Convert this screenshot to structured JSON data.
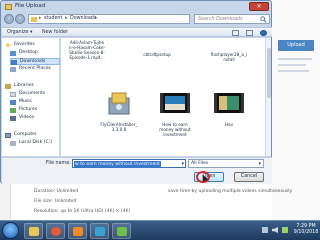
{
  "dialog": {
    "title": "File Upload",
    "close_label": "✕",
    "address": {
      "crumbs": [
        "student",
        "Downloads"
      ],
      "search_placeholder": "Search Downloads"
    },
    "toolbar": {
      "organize": "Organize ▾",
      "new_folder": "New folder"
    },
    "nav": {
      "favorites": "Favorites",
      "desktop": "Desktop",
      "downloads": "Downloads",
      "recent_places": "Recent Places",
      "libraries": "Libraries",
      "documents": "Documents",
      "music": "Music",
      "pictures": "Pictures",
      "videos": "Videos",
      "computer": "Computer",
      "local_disk": "Local Disk (C:)"
    },
    "files": [
      {
        "caption": "Adil-Aslam-Tujhe\nn-e-Hasam-Coke-\nStudio-Season-8-\nEpisode-1.mp4..."
      },
      {
        "caption": "cbtcdtpsetup"
      },
      {
        "caption": "flashplayer28_a_i\nnstall"
      },
      {
        "caption": "FlyClientInstaller_\n3.3.0.6"
      },
      {
        "caption": "How to earn\nmoney without\ninvestment"
      },
      {
        "caption": "Hav"
      }
    ],
    "file_name_label": "File name:",
    "file_name_value": "w to earn money without investment",
    "file_type_value": "All Files",
    "open_label": "Open",
    "cancel_label": "Cancel"
  },
  "background": {
    "upload_button": "Upload",
    "duration": "Duration: Unlimited",
    "file_size": "File size: Unlimited",
    "resolution": "Resolution: up to 1K (Ultra HD) (4K) × (4K)",
    "tip": "save time by uploading multiple videos simultaneously"
  },
  "taskbar": {
    "time": "7:29 PM",
    "date": "9/10/2018"
  },
  "colors": {
    "dialog_bg": "#c7d6e8",
    "accent": "#3a77c9",
    "taskbar": "#1e3a5e",
    "close": "#c7433a"
  }
}
